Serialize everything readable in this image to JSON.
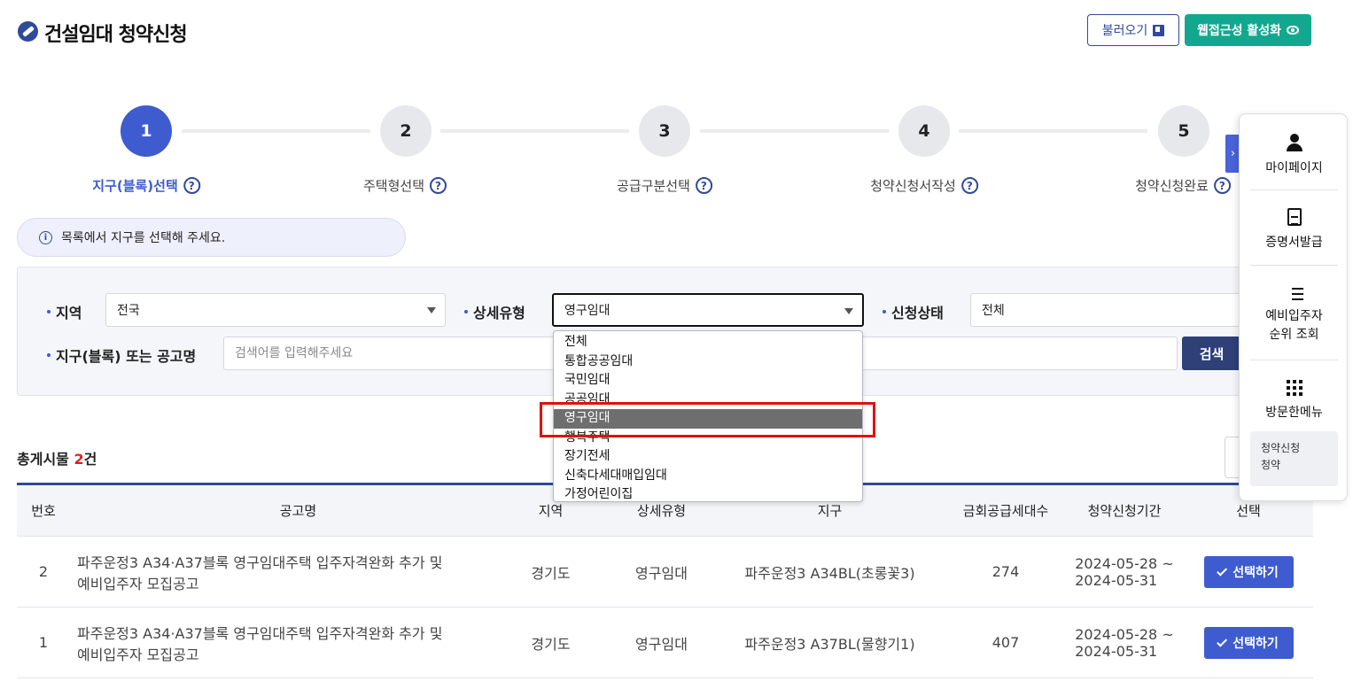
{
  "header": {
    "title": "건설임대 청약신청",
    "load_button": "불러오기",
    "accessibility_button": "웹접근성 활성화"
  },
  "stepper": {
    "steps": [
      {
        "number": "1",
        "label": "지구(블록)선택"
      },
      {
        "number": "2",
        "label": "주택형선택"
      },
      {
        "number": "3",
        "label": "공급구분선택"
      },
      {
        "number": "4",
        "label": "청약신청서작성"
      },
      {
        "number": "5",
        "label": "청약신청완료"
      }
    ],
    "active_step": 1,
    "help_glyph": "?"
  },
  "notice": {
    "icon_glyph": "i",
    "text": "목록에서 지구를 선택해 주세요."
  },
  "filters": {
    "region_label": "지역",
    "region_value": "전국",
    "detail_type_label": "상세유형",
    "detail_type_value": "영구임대",
    "status_label": "신청상태",
    "status_value": "전체",
    "block_label": "지구(블록) 또는 공고명",
    "search_placeholder": "검색어를 입력해주세요",
    "search_button": "검색"
  },
  "detail_type_dropdown": {
    "options": [
      "전체",
      "통합공공임대",
      "국민임대",
      "공공임대",
      "영구임대",
      "행복주택",
      "장기전세",
      "신축다세대매입임대",
      "가정어린이집"
    ],
    "selected": "영구임대"
  },
  "results": {
    "count_prefix": "총게시물 ",
    "count": "2",
    "count_suffix": "건"
  },
  "table": {
    "headers": [
      "번호",
      "공고명",
      "지역",
      "상세유형",
      "지구",
      "금회공급세대수",
      "청약신청기간",
      "선택"
    ],
    "rows": [
      {
        "no": "2",
        "title_line1": "파주운정3 A34·A37블록 영구임대주택 입주자격완화 추가 및",
        "title_line2": "예비입주자 모집공고",
        "region": "경기도",
        "type": "영구임대",
        "district": "파주운정3 A34BL(초롱꽃3)",
        "units": "274",
        "period_start": "2024-05-28 ~",
        "period_end": "2024-05-31",
        "select_label": "선택하기"
      },
      {
        "no": "1",
        "title_line1": "파주운정3 A34·A37블록 영구임대주택 입주자격완화 추가 및",
        "title_line2": "예비입주자 모집공고",
        "region": "경기도",
        "type": "영구임대",
        "district": "파주운정3 A37BL(물향기1)",
        "units": "407",
        "period_start": "2024-05-28 ~",
        "period_end": "2024-05-31",
        "select_label": "선택하기"
      }
    ]
  },
  "side_menu": {
    "items": [
      {
        "icon": "person-icon",
        "label": "마이페이지"
      },
      {
        "icon": "document-icon",
        "label": "증명서발급"
      },
      {
        "icon": "numbered-list-icon",
        "label_line1": "예비입주자",
        "label_line2": "순위 조회"
      },
      {
        "icon": "grid-icon",
        "label": "방문한메뉴"
      }
    ],
    "visited_line1": "청약신청",
    "visited_line2": "청약"
  },
  "colors": {
    "primary": "#3e5bcf",
    "navy": "#2f4a9a",
    "accent_green": "#12a890",
    "highlight_red": "#e01010"
  }
}
